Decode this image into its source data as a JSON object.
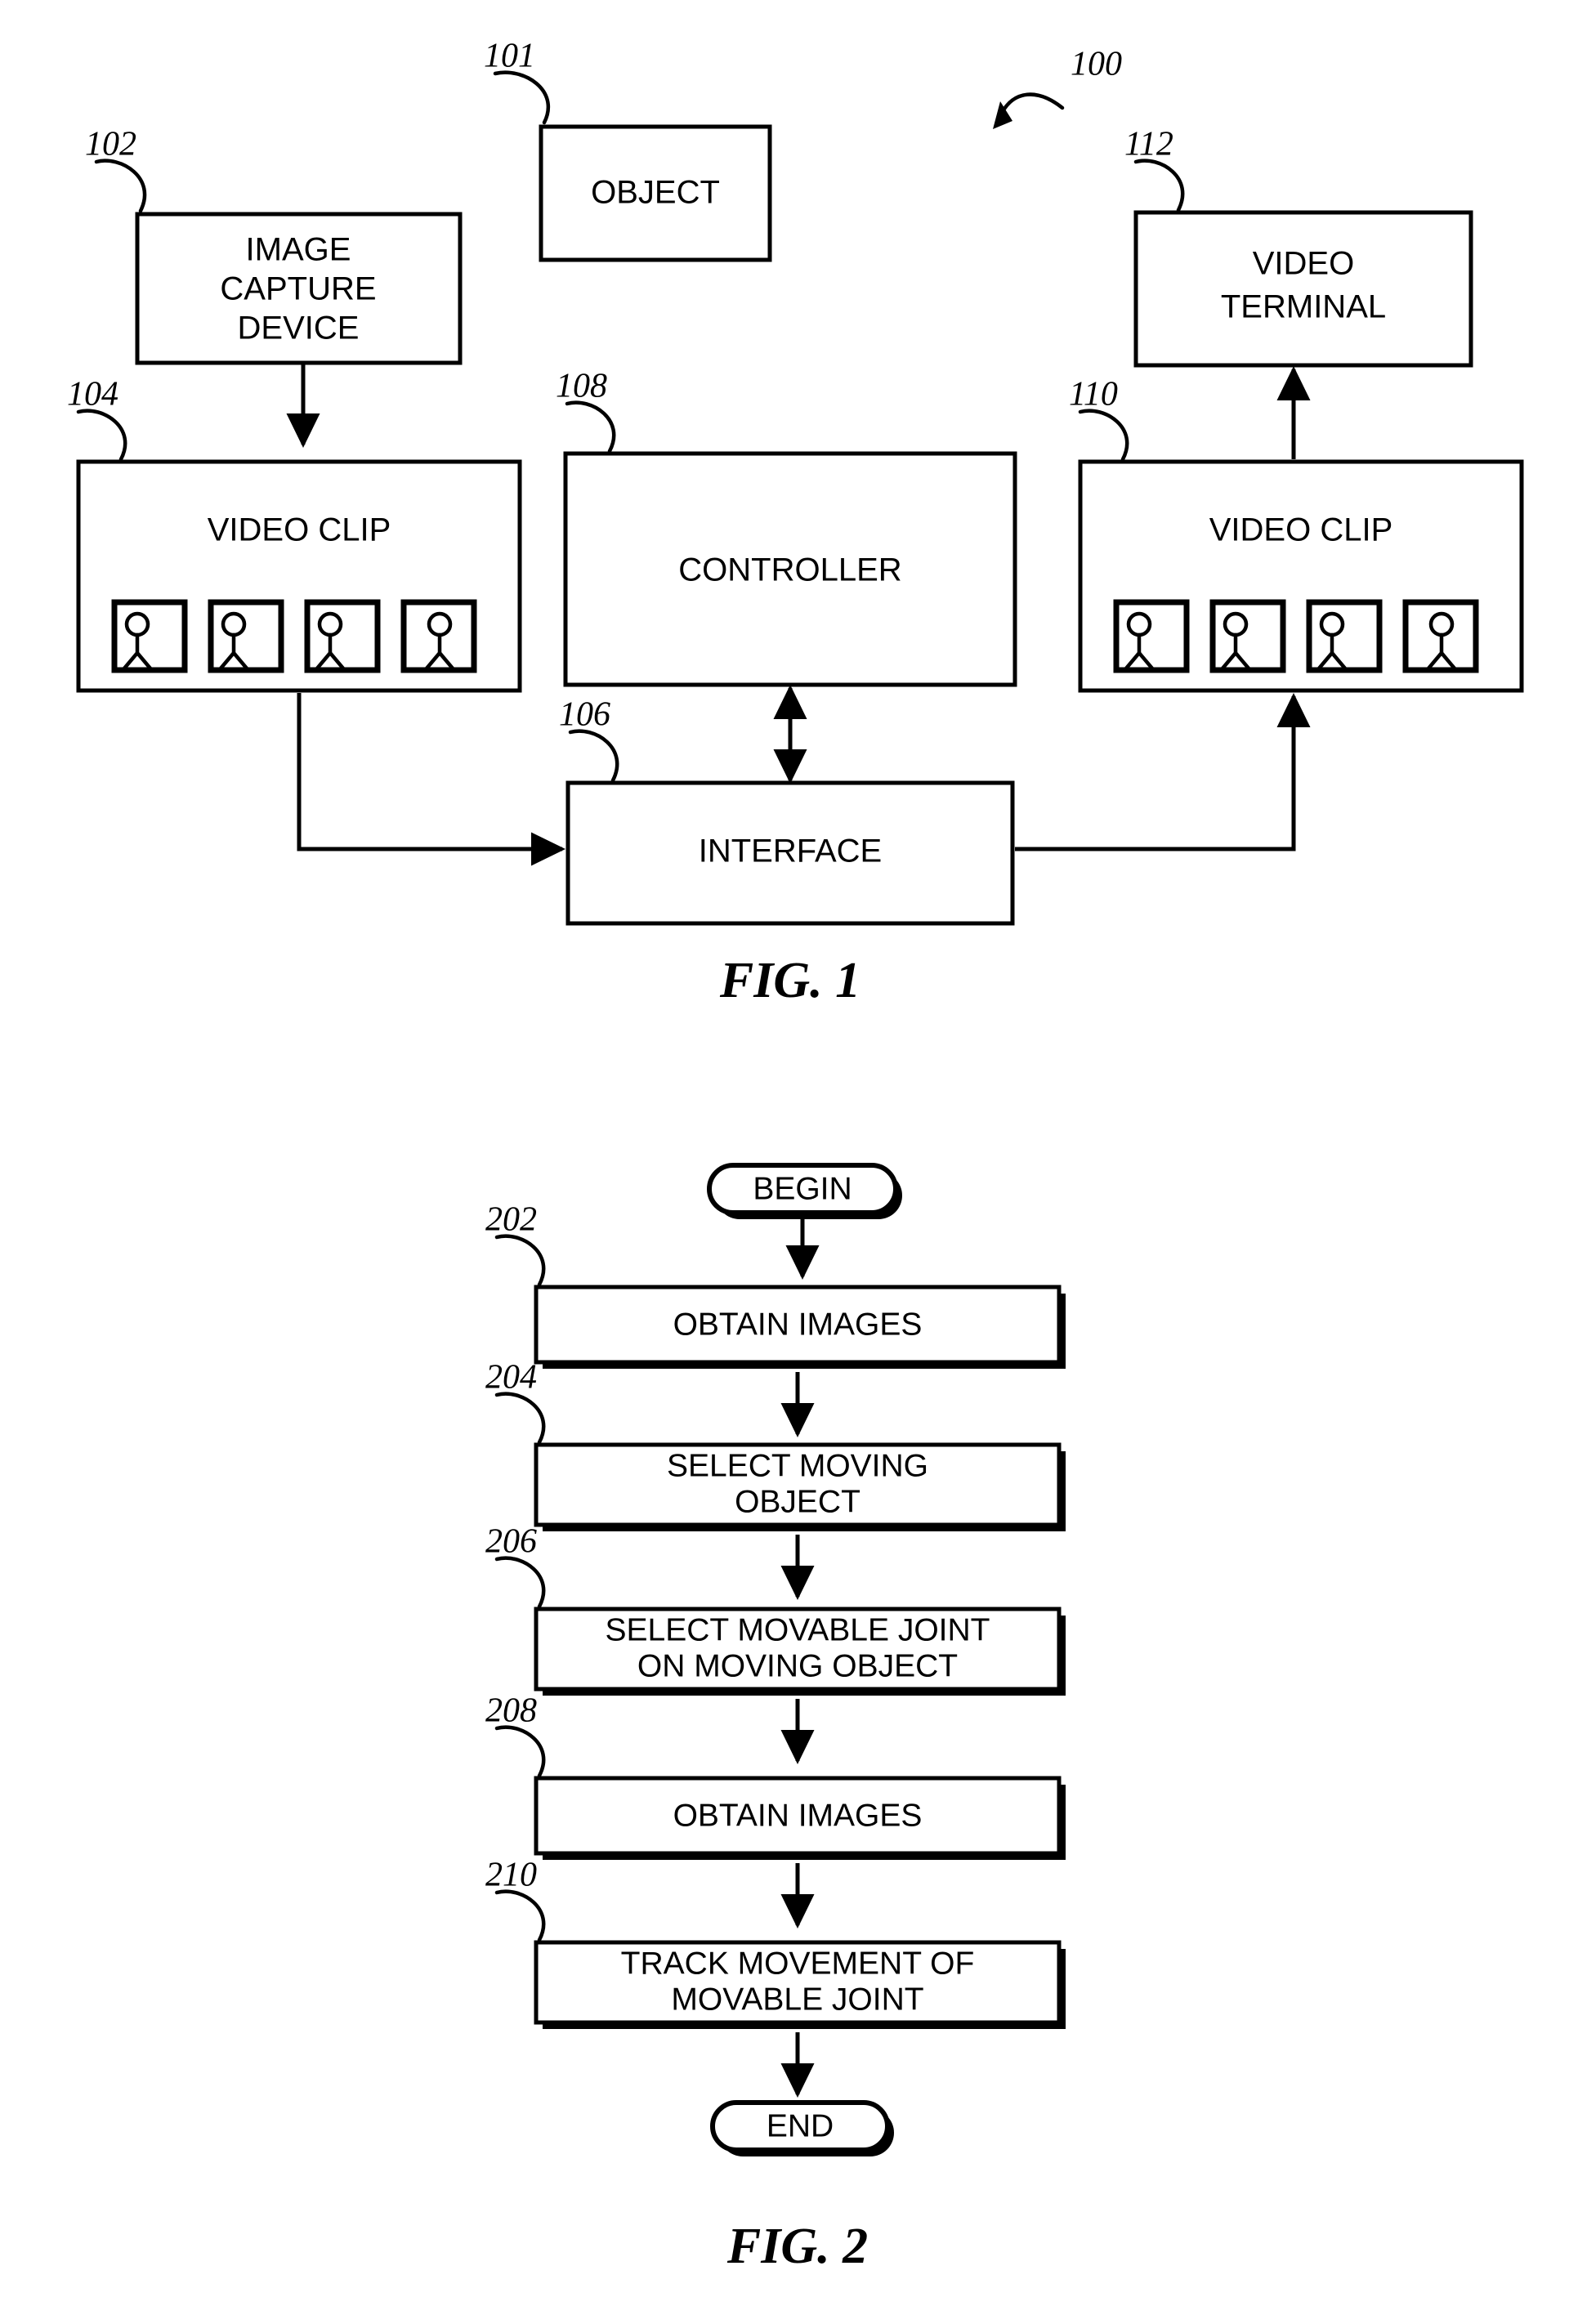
{
  "document": {
    "type": "patent-figure-sheet",
    "figures": [
      "FIG. 1",
      "FIG. 2"
    ]
  },
  "figure1": {
    "label": "FIG. 1",
    "system_ref": "100",
    "blocks": [
      {
        "ref": "101",
        "label": "OBJECT"
      },
      {
        "ref": "102",
        "label": "IMAGE CAPTURE DEVICE",
        "lines": [
          "IMAGE",
          "CAPTURE",
          "DEVICE"
        ]
      },
      {
        "ref": "104",
        "label": "VIDEO CLIP",
        "frames": 4
      },
      {
        "ref": "106",
        "label": "INTERFACE"
      },
      {
        "ref": "108",
        "label": "CONTROLLER"
      },
      {
        "ref": "110",
        "label": "VIDEO CLIP",
        "frames": 4
      },
      {
        "ref": "112",
        "label": "VIDEO TERMINAL",
        "lines": [
          "VIDEO",
          "TERMINAL"
        ]
      }
    ],
    "connections": [
      {
        "from": "102",
        "to": "104",
        "style": "arrow-down"
      },
      {
        "from": "104",
        "to": "106",
        "style": "elbow-arrow-right"
      },
      {
        "from": "108",
        "to": "106",
        "style": "double-arrow-vertical"
      },
      {
        "from": "106",
        "to": "110",
        "style": "elbow-arrow-up"
      },
      {
        "from": "110",
        "to": "112",
        "style": "arrow-up"
      }
    ]
  },
  "figure2": {
    "label": "FIG. 2",
    "begin_label": "BEGIN",
    "end_label": "END",
    "steps": [
      {
        "ref": "202",
        "lines": [
          "OBTAIN IMAGES"
        ]
      },
      {
        "ref": "204",
        "lines": [
          "SELECT MOVING",
          "OBJECT"
        ]
      },
      {
        "ref": "206",
        "lines": [
          "SELECT MOVABLE JOINT",
          "ON MOVING OBJECT"
        ]
      },
      {
        "ref": "208",
        "lines": [
          "OBTAIN IMAGES"
        ]
      },
      {
        "ref": "210",
        "lines": [
          "TRACK MOVEMENT OF",
          "MOVABLE JOINT"
        ]
      }
    ]
  },
  "colors": {
    "ink": "#000000",
    "paper": "#ffffff"
  }
}
